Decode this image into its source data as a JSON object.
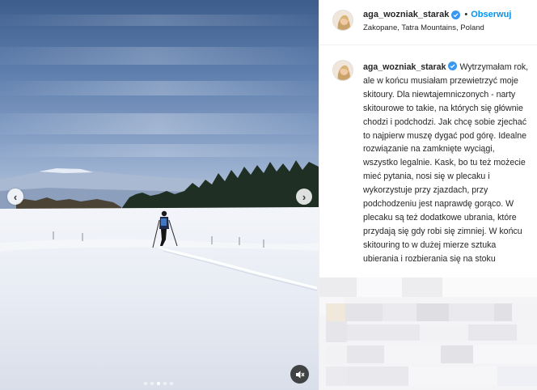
{
  "post": {
    "username": "aga_wozniak_starak",
    "separator": "•",
    "follow_label": "Obserwuj",
    "location": "Zakopane, Tatra Mountains, Poland",
    "more_label": "•••",
    "caption": "Wytrzymałam rok, ale w końcu musiałam przewietrzyć moje skitoury. Dla niewtajemniczonych - narty skitourowe to takie, na których się głównie chodzi i podchodzi. Jak chcę sobie zjechać to najpierw muszę dygać pod górę. Idealne rozwiązanie na zamknięte wyciągi, wszystko legalnie. Kask, bo tu też możecie mieć pytania, nosi się w plecaku i wykorzystuje przy zjazdach, przy podchodzeniu jest naprawdę gorąco. W plecaku są też dodatkowe ubrania, które przydają się gdy robi się zimniej. W końcu skitouring to w dużej mierze sztuka ubierania i rozbierania się na stoku"
  },
  "media": {
    "prev_label": "‹",
    "next_label": "›",
    "carousel_total": 5,
    "carousel_active": 2
  },
  "icons": {
    "verified": "verified-badge-icon",
    "mute": "mute-icon",
    "prev": "chevron-left-icon",
    "next": "chevron-right-icon"
  },
  "colors": {
    "follow": "#0095f6",
    "verified": "#3897f0",
    "sky_top": "#3f5f8f",
    "snow": "#eef1f7"
  }
}
